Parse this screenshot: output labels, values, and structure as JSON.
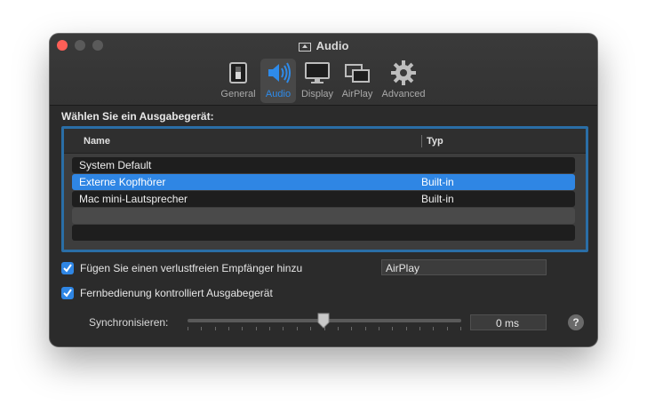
{
  "window": {
    "title": "Audio"
  },
  "toolbar": {
    "items": [
      {
        "label": "General",
        "icon": "general-switch-icon"
      },
      {
        "label": "Audio",
        "icon": "speaker-icon",
        "active": true
      },
      {
        "label": "Display",
        "icon": "monitor-icon"
      },
      {
        "label": "AirPlay",
        "icon": "airplay-windows-icon"
      },
      {
        "label": "Advanced",
        "icon": "gear-icon"
      }
    ]
  },
  "output": {
    "label": "Wählen Sie ein Ausgabegerät:",
    "columns": {
      "name": "Name",
      "type": "Typ"
    },
    "rows": [
      {
        "name": "System Default",
        "type": ""
      },
      {
        "name": "Externe Kopfhörer",
        "type": "Built-in",
        "selected": true
      },
      {
        "name": "Mac mini-Lautsprecher",
        "type": "Built-in"
      }
    ]
  },
  "options": {
    "lossless_receiver": {
      "label": "Fügen Sie einen verlustfreien Empfänger hinzu",
      "checked": true,
      "value": "AirPlay"
    },
    "remote_control": {
      "label": "Fernbedienung kontrolliert Ausgabegerät",
      "checked": true
    }
  },
  "sync": {
    "label": "Synchronisieren:",
    "value": "0 ms",
    "position": 0.5
  },
  "help": {
    "label": "?"
  },
  "colors": {
    "accent": "#2f86e4",
    "close": "#ff5f57",
    "frame": "#2a6ea6"
  }
}
